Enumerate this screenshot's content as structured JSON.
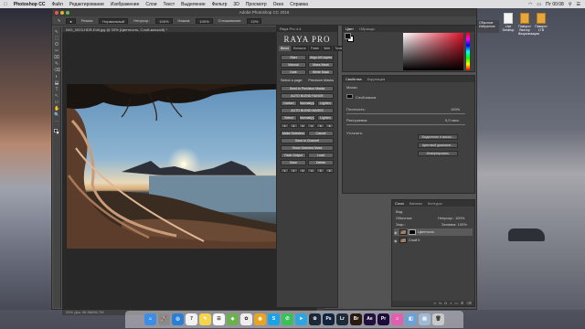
{
  "menubar": {
    "apple": "",
    "app_name": "Photoshop CC",
    "items": [
      "Файл",
      "Редактирование",
      "Изображение",
      "Слои",
      "Текст",
      "Выделение",
      "Фильтр",
      "3D",
      "Просмотр",
      "Окно",
      "Справка"
    ],
    "clock": "Пт 00:08"
  },
  "window": {
    "title": "Adobe Photoshop CC 2016",
    "doc_tab": "IMG_0923-HDR-Edit.jpg @ 33% (Цветность, Слой-маска/8) *",
    "status": "33%   Док: 96.9M/96.7M"
  },
  "options_bar": {
    "mode_label": "Режим:",
    "mode_value": "Нормальный",
    "opacity_label": "Непрозр.:",
    "opacity_value": "100%",
    "flow_label": "Нажим:",
    "flow_value": "100%",
    "smooth_label": "Сглаживание:",
    "smooth_value": "10%"
  },
  "tools": [
    "⇖",
    "⬚",
    "ʘ",
    "✂",
    "⌧",
    "✎",
    "⌫",
    "◐",
    "⬓",
    "T",
    "↖",
    "▭",
    "✋",
    "🔍",
    "⋯"
  ],
  "raya": {
    "header": "Raya Pro 4.4",
    "logo": "RAYA PRO",
    "tabs": [
      "Blend",
      "Enhance",
      "Finish",
      "Web",
      "Tools",
      "Info"
    ],
    "buttons_top": [
      "Start",
      "Align All Layers",
      "Manual",
      "Mass Mask",
      "Dark",
      "White Mask"
    ],
    "select_label": "Select a page:",
    "select_value": "Precision Masks",
    "buttons_mid": [
      "Send to Precision Masks",
      "AUTO BLEND RANGE",
      "Darken",
      "Normally(28)",
      "Lighten",
      "AUTO BLEND MASKS",
      "Select",
      "Normally(28)",
      "Lighten"
    ],
    "buttons_low": [
      "Make Selection",
      "Cancel",
      "Save to Channel",
      "Show Selected Mask",
      "Fade Output",
      "Load",
      "Save",
      "Delete"
    ],
    "mini_row": [
      "1",
      "2",
      "3",
      "4",
      "5",
      "6"
    ]
  },
  "color_panel": {
    "tabs": [
      "Цвет",
      "Образцы"
    ],
    "accent": "#e0112a"
  },
  "properties": {
    "tabs": [
      "Свойства",
      "Коррекция"
    ],
    "title": "Маски",
    "mask_label": "Слой-маска",
    "density_label": "Плотность:",
    "density_value": "100%",
    "feather_label": "Растушевка:",
    "feather_value": "0,0 пикс.",
    "refine_label": "Уточнить:",
    "btn1": "Выделение и маска...",
    "btn2": "Цветовой диапазон...",
    "btn3": "Инвертировать"
  },
  "layers": {
    "tabs": [
      "Слои",
      "Каналы",
      "Контуры"
    ],
    "kind": "Вид",
    "blend": "Обычные",
    "opacity": "Непрозр.: 100%",
    "lock": "Закр.:",
    "fill": "Заливка: 100%",
    "items": [
      {
        "name": "Цветность",
        "selected": true
      },
      {
        "name": "Слой 0",
        "selected": false
      }
    ]
  },
  "desktop": {
    "widget_lines": [
      "Обычные",
      "Избранное"
    ],
    "icons": [
      {
        "label": "Live Desktop"
      },
      {
        "label": "Поворот Вектор Визуализация"
      },
      {
        "label": "Поворот 1TB"
      }
    ]
  },
  "dock": {
    "apps": [
      {
        "name": "finder-icon",
        "glyph": "☺",
        "color": "#3b8de8"
      },
      {
        "name": "launchpad-icon",
        "glyph": "🚀",
        "color": "#8a8a8a"
      },
      {
        "name": "safari-icon",
        "glyph": "◎",
        "color": "#2a7fd4"
      },
      {
        "name": "calendar-icon",
        "glyph": "7",
        "color": "#f2f2f2"
      },
      {
        "name": "notes-icon",
        "glyph": "✎",
        "color": "#f5d54a"
      },
      {
        "name": "reminders-icon",
        "glyph": "☰",
        "color": "#f7f7f7"
      },
      {
        "name": "maps-icon",
        "glyph": "◈",
        "color": "#6ab04c"
      },
      {
        "name": "photos-icon",
        "glyph": "✿",
        "color": "#eeeeee"
      },
      {
        "name": "chrome-icon",
        "glyph": "◉",
        "color": "#e9a520"
      },
      {
        "name": "skype-icon",
        "glyph": "S",
        "color": "#1aa3e8"
      },
      {
        "name": "whatsapp-icon",
        "glyph": "✆",
        "color": "#38c05b"
      },
      {
        "name": "telegram-icon",
        "glyph": "➤",
        "color": "#2ca5e0"
      },
      {
        "name": "steam-icon",
        "glyph": "⚙",
        "color": "#1b2838"
      },
      {
        "name": "photoshop-icon",
        "glyph": "Ps",
        "color": "#10233f"
      },
      {
        "name": "lightroom-icon",
        "glyph": "Lr",
        "color": "#1d2b38"
      },
      {
        "name": "bridge-icon",
        "glyph": "Br",
        "color": "#2b1a0f"
      },
      {
        "name": "aftereffects-icon",
        "glyph": "Ae",
        "color": "#1f0f3a"
      },
      {
        "name": "premiere-icon",
        "glyph": "Pr",
        "color": "#1e0b3b"
      },
      {
        "name": "itunes-icon",
        "glyph": "♫",
        "color": "#e15fb1"
      },
      {
        "name": "preview-icon",
        "glyph": "◧",
        "color": "#6aa2d8"
      },
      {
        "name": "documents-icon",
        "glyph": "▤",
        "color": "#9fb9d6"
      },
      {
        "name": "trash-icon",
        "glyph": "🗑",
        "color": "#c9c9c9"
      }
    ]
  }
}
